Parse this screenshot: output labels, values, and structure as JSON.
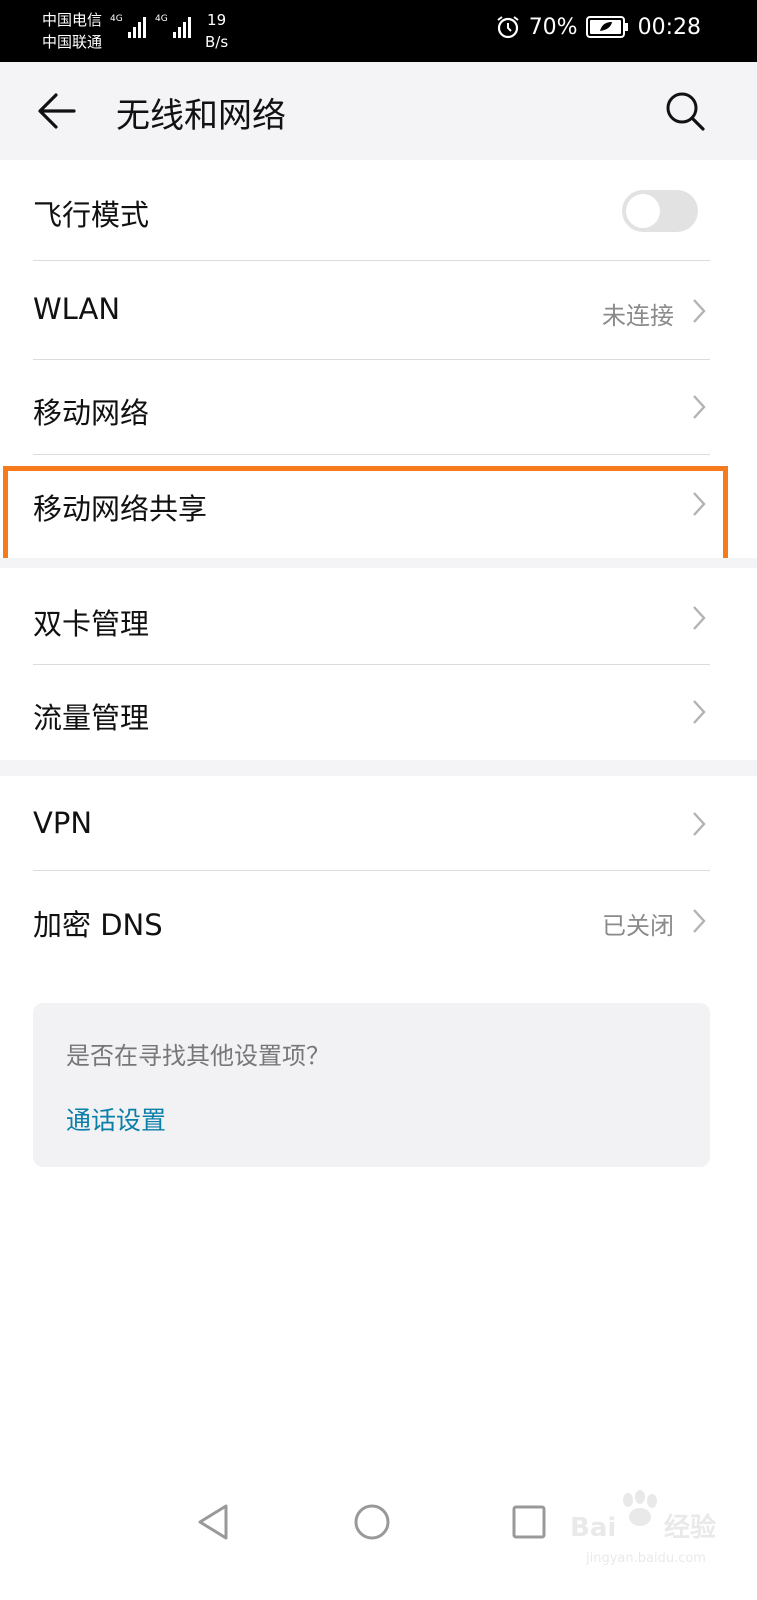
{
  "status_bar": {
    "carrier1": "中国电信",
    "carrier2": "中国联通",
    "net1": "4G",
    "net2": "4G",
    "speed_value": "19",
    "speed_unit": "B/s",
    "battery": "70%",
    "time": "00:28"
  },
  "header": {
    "title": "无线和网络"
  },
  "items": [
    {
      "label": "飞行模式",
      "toggle": false
    },
    {
      "label": "WLAN",
      "value": "未连接"
    },
    {
      "label": "移动网络"
    },
    {
      "label": "移动网络共享",
      "highlighted": true
    },
    {
      "label": "双卡管理"
    },
    {
      "label": "流量管理"
    },
    {
      "label": "VPN"
    },
    {
      "label": "加密 DNS",
      "value": "已关闭"
    }
  ],
  "suggestion": {
    "question": "是否在寻找其他设置项？",
    "link": "通话设置"
  },
  "colors": {
    "highlight": "#f77b1d",
    "link": "#0a7fa8"
  },
  "watermark": {
    "brand": "Baidu",
    "cn": "经验",
    "url": "jingyan.baidu.com"
  }
}
